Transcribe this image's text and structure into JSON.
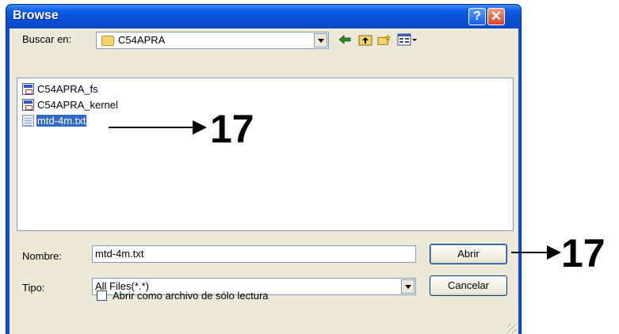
{
  "window": {
    "title": "Browse",
    "help_glyph": "?",
    "close_glyph": "✕"
  },
  "lookin": {
    "label": "Buscar en:",
    "value": "C54APRA"
  },
  "toolbar": {
    "icons": [
      "back-arrow-icon",
      "up-folder-icon",
      "new-folder-icon",
      "view-menu-icon"
    ]
  },
  "files": [
    {
      "name": "C54APRA_fs",
      "type": "app"
    },
    {
      "name": "C54APRA_kernel",
      "type": "app"
    },
    {
      "name": "mtd-4m.txt",
      "type": "text",
      "selected": true
    }
  ],
  "filename": {
    "label": "Nombre:",
    "value": "mtd-4m.txt"
  },
  "filetype": {
    "label": "Tipo:",
    "value": "All Files(*.*)"
  },
  "readonly": {
    "label": "Abrir como archivo de sólo lectura",
    "checked": false
  },
  "buttons": {
    "open": "Abrir",
    "cancel": "Cancelar"
  },
  "annotations": {
    "list_step": "17",
    "open_step": "17"
  },
  "colors": {
    "title_bar": "#0b4fd8",
    "selection": "#316ac5",
    "dialog_bg": "#ece9d8"
  }
}
